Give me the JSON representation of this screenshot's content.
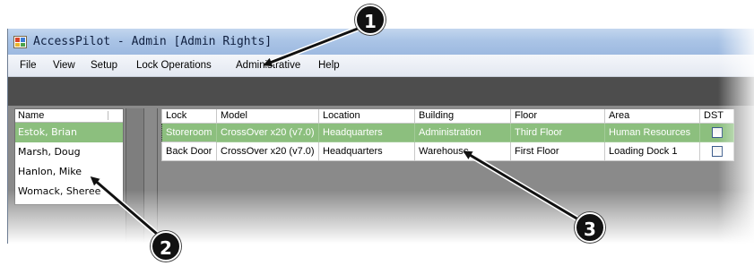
{
  "window": {
    "title": "AccessPilot - Admin [Admin Rights]"
  },
  "menu": [
    "File",
    "View",
    "Setup",
    "Lock Operations",
    "Administrative",
    "Help"
  ],
  "user_list": {
    "header": "Name",
    "items": [
      {
        "name": "Estok, Brian",
        "selected": true
      },
      {
        "name": "Marsh, Doug",
        "selected": false
      },
      {
        "name": "Hanlon, Mike",
        "selected": false
      },
      {
        "name": "Womack, Sheree",
        "selected": false
      }
    ]
  },
  "locks_grid": {
    "columns": [
      "Lock",
      "Model",
      "Location",
      "Building",
      "Floor",
      "Area",
      "DST"
    ],
    "rows": [
      {
        "lock": "Storeroom",
        "model": "CrossOver x20 (v7.0)",
        "location": "Headquarters",
        "building": "Administration",
        "floor": "Third Floor",
        "area": "Human Resources",
        "dst": false,
        "selected": true
      },
      {
        "lock": "Back Door",
        "model": "CrossOver x20 (v7.0)",
        "location": "Headquarters",
        "building": "Warehouse",
        "floor": "First Floor",
        "area": "Loading Dock 1",
        "dst": false,
        "selected": false
      }
    ]
  },
  "callouts": [
    "1",
    "2",
    "3"
  ],
  "colors": {
    "selection": "#8cbf7e",
    "titlebar": "#aac4e6",
    "toolbar": "#4d4d4d",
    "background": "#8a8a8a"
  },
  "icons": [
    "app-icon"
  ]
}
